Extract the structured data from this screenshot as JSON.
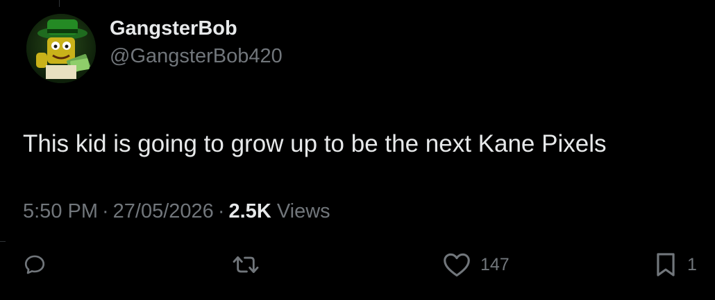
{
  "user": {
    "display_name": "GangsterBob",
    "handle": "@GangsterBob420"
  },
  "tweet": {
    "text": "This kid is going to grow up to be the next Kane Pixels"
  },
  "meta": {
    "time": "5:50 PM",
    "separator": "·",
    "date": "27/05/2026",
    "views_count": "2.5K",
    "views_label": "Views"
  },
  "actions": {
    "reply": {
      "icon": "reply-icon"
    },
    "retweet": {
      "icon": "retweet-icon"
    },
    "like": {
      "icon": "heart-icon",
      "count": "147"
    },
    "bookmark": {
      "icon": "bookmark-icon",
      "count": "1"
    }
  },
  "colors": {
    "background": "#000000",
    "primary_text": "#e7e9ea",
    "secondary_text": "#71767b"
  }
}
